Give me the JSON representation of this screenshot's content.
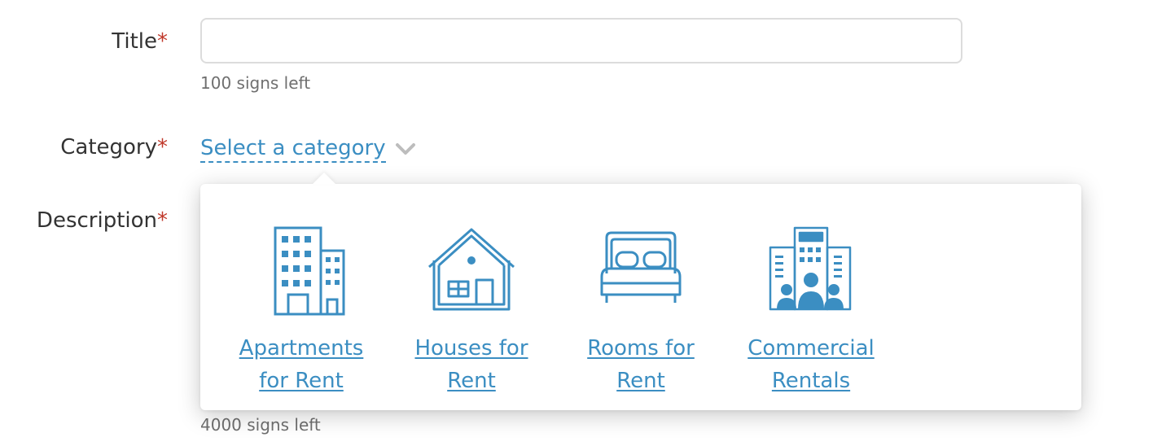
{
  "form": {
    "title_label": "Title",
    "required_mark": "*",
    "title_value": "",
    "title_hint": "100 signs left",
    "category_label": "Category",
    "category_placeholder": "Select a category",
    "description_label": "Description",
    "description_hint": "4000 signs left"
  },
  "dropdown": {
    "categories": [
      {
        "label_line1": "Apartments",
        "label_line2": "for Rent",
        "icon": "apartment-building-icon"
      },
      {
        "label_line1": "Houses for",
        "label_line2": "Rent",
        "icon": "house-icon"
      },
      {
        "label_line1": "Rooms for",
        "label_line2": "Rent",
        "icon": "bed-icon"
      },
      {
        "label_line1": "Commercial",
        "label_line2": "Rentals",
        "icon": "commercial-building-icon"
      }
    ]
  },
  "colors": {
    "accent": "#3b8ec2",
    "required": "#c0392b",
    "hint": "#6f6f6f",
    "text": "#333333"
  }
}
